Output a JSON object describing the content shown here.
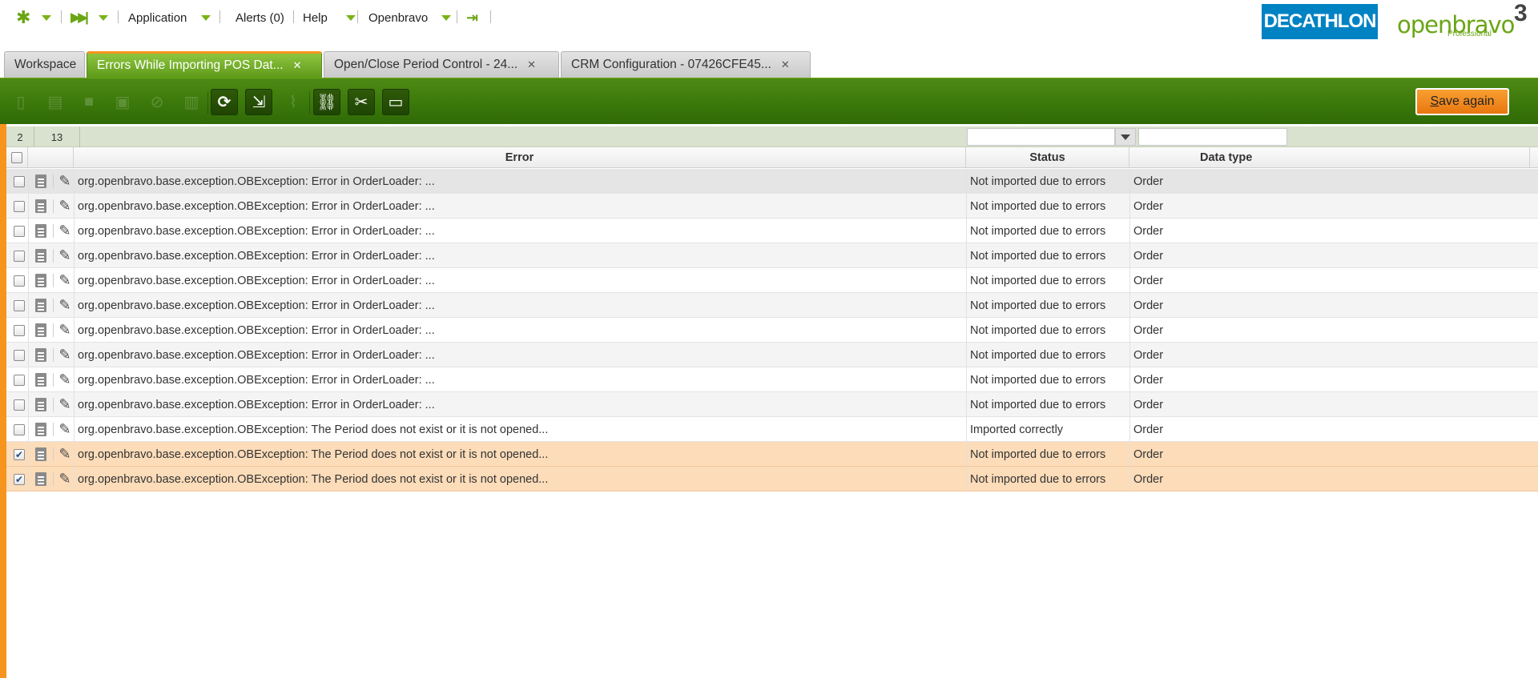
{
  "topnav": {
    "quick_launch_icon": "asterisk-icon",
    "recent_icon": "fast-forward-icon",
    "application_label": "Application",
    "alerts_label": "Alerts (0)",
    "help_label": "Help",
    "user_label": "Openbravo",
    "logout_icon": "logout-icon"
  },
  "brand": {
    "customer_logo": "DECATHLON",
    "product_logo": "openbravo",
    "product_version": "3",
    "product_edition": "Professional"
  },
  "tabs": [
    {
      "label": "Workspace",
      "closable": false,
      "active": false
    },
    {
      "label": "Errors While Importing POS Dat...",
      "closable": true,
      "active": true
    },
    {
      "label": "Open/Close Period Control - 24...",
      "closable": true,
      "active": false
    },
    {
      "label": "CRM Configuration - 07426CFE45...",
      "closable": true,
      "active": false
    }
  ],
  "toolbar": {
    "buttons": [
      {
        "icon": "new-document-icon",
        "enabled": false
      },
      {
        "icon": "new-row-icon",
        "enabled": false
      },
      {
        "icon": "save-icon",
        "enabled": false
      },
      {
        "icon": "save-close-icon",
        "enabled": false
      },
      {
        "icon": "undo-icon",
        "enabled": false
      },
      {
        "icon": "delete-icon",
        "enabled": false
      },
      {
        "icon": "refresh-icon",
        "enabled": true
      },
      {
        "icon": "export-icon",
        "enabled": true
      },
      {
        "icon": "attachment-icon",
        "enabled": false
      },
      {
        "icon": "link-icon",
        "enabled": true
      },
      {
        "icon": "tools-icon",
        "enabled": true
      },
      {
        "icon": "grid-view-icon",
        "enabled": true
      }
    ],
    "save_again_label": "Save again",
    "save_again_accesskey": "S"
  },
  "grid": {
    "selected_count": "2",
    "total_count": "13",
    "columns": [
      "Error",
      "Status",
      "Data type"
    ],
    "rows": [
      {
        "checked": false,
        "error": "org.openbravo.base.exception.OBException: Error in OrderLoader: ...",
        "status": "Not imported due to errors",
        "type": "Order"
      },
      {
        "checked": false,
        "error": "org.openbravo.base.exception.OBException: Error in OrderLoader: ...",
        "status": "Not imported due to errors",
        "type": "Order"
      },
      {
        "checked": false,
        "error": "org.openbravo.base.exception.OBException: Error in OrderLoader: ...",
        "status": "Not imported due to errors",
        "type": "Order"
      },
      {
        "checked": false,
        "error": "org.openbravo.base.exception.OBException: Error in OrderLoader: ...",
        "status": "Not imported due to errors",
        "type": "Order"
      },
      {
        "checked": false,
        "error": "org.openbravo.base.exception.OBException: Error in OrderLoader: ...",
        "status": "Not imported due to errors",
        "type": "Order"
      },
      {
        "checked": false,
        "error": "org.openbravo.base.exception.OBException: Error in OrderLoader: ...",
        "status": "Not imported due to errors",
        "type": "Order"
      },
      {
        "checked": false,
        "error": "org.openbravo.base.exception.OBException: Error in OrderLoader: ...",
        "status": "Not imported due to errors",
        "type": "Order"
      },
      {
        "checked": false,
        "error": "org.openbravo.base.exception.OBException: Error in OrderLoader: ...",
        "status": "Not imported due to errors",
        "type": "Order"
      },
      {
        "checked": false,
        "error": "org.openbravo.base.exception.OBException: Error in OrderLoader: ...",
        "status": "Not imported due to errors",
        "type": "Order"
      },
      {
        "checked": false,
        "error": "org.openbravo.base.exception.OBException: Error in OrderLoader: ...",
        "status": "Not imported due to errors",
        "type": "Order"
      },
      {
        "checked": false,
        "error": "org.openbravo.base.exception.OBException: The Period does not exist or it is not opened...",
        "status": "Imported correctly",
        "type": "Order"
      },
      {
        "checked": true,
        "error": "org.openbravo.base.exception.OBException: The Period does not exist or it is not opened...",
        "status": "Not imported due to errors",
        "type": "Order"
      },
      {
        "checked": true,
        "error": "org.openbravo.base.exception.OBException: The Period does not exist or it is not opened...",
        "status": "Not imported due to errors",
        "type": "Order"
      }
    ]
  },
  "colors": {
    "toolbar_green": "#3d7a0c",
    "accent_orange": "#f7941d",
    "selected_row": "#fcdcb9",
    "decathlon_blue": "#0082c3",
    "openbravo_green": "#6aa514"
  }
}
